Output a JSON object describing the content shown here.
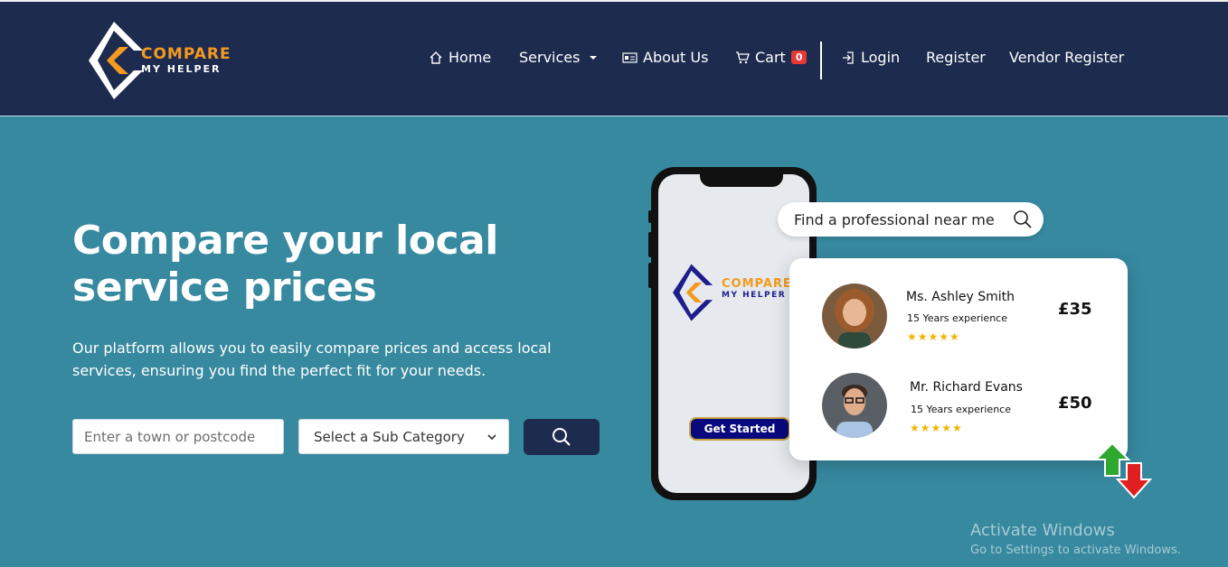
{
  "brand": {
    "line1": "COMPARE",
    "line2": "MY HELPER"
  },
  "nav": {
    "home": "Home",
    "services": "Services",
    "about": "About Us",
    "cart": "Cart",
    "cart_count": "0",
    "login": "Login",
    "register": "Register",
    "vendor_register": "Vendor Register"
  },
  "hero": {
    "title": "Compare your local service prices",
    "description": "Our platform allows you to easily compare prices and access local services, ensuring you find the perfect fit for your needs.",
    "town_placeholder": "Enter a town or postcode",
    "subcategory_selected": "Select a Sub Category"
  },
  "phone": {
    "logo_line1": "COMPARE",
    "logo_line2": "MY HELPER",
    "get_started": "Get Started"
  },
  "find_pill": "Find a professional near me",
  "professionals": [
    {
      "name": "Ms. Ashley Smith",
      "experience": "15 Years experience",
      "stars": "★★★★★",
      "rating": 4.5,
      "price": "£35"
    },
    {
      "name": "Mr. Richard Evans",
      "experience": "15 Years experience",
      "stars": "★★★★★",
      "rating": 4.5,
      "price": "£50"
    }
  ],
  "watermark": {
    "line1": "Activate Windows",
    "line2": "Go to Settings to activate Windows."
  },
  "colors": {
    "header": "#1d2b4f",
    "hero": "#3789a0",
    "accent": "#f39a1f",
    "badge": "#e53935"
  }
}
